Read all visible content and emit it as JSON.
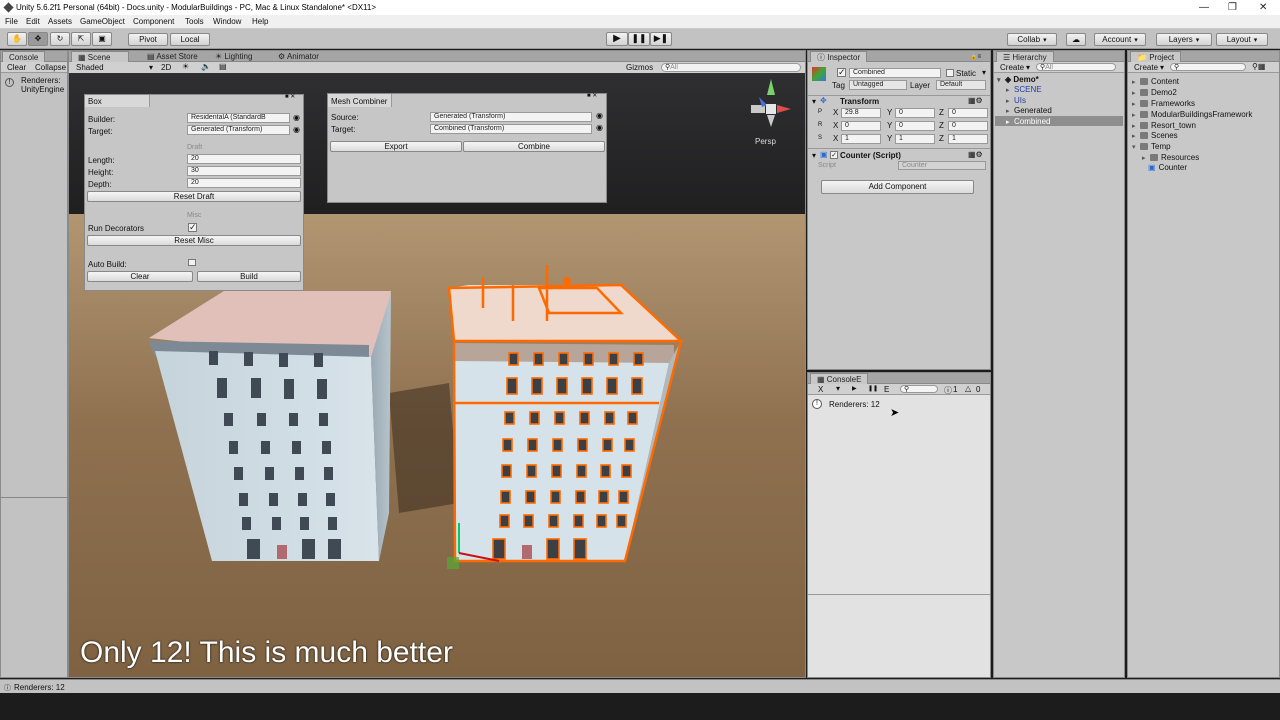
{
  "window": {
    "title": "Unity 5.6.2f1 Personal (64bit) - Docs.unity - ModularBuildings - PC, Mac & Linux Standalone* <DX11>",
    "controls": [
      "—",
      "❐",
      "✕"
    ]
  },
  "menu": [
    "File",
    "Edit",
    "Assets",
    "GameObject",
    "Component",
    "Tools",
    "Window",
    "Help"
  ],
  "toolbar": {
    "pivot": "Pivot",
    "local": "Local",
    "collab": "Collab",
    "account": "Account",
    "layers": "Layers",
    "layout": "Layout"
  },
  "console_left": {
    "tab": "Console",
    "clear": "Clear",
    "collapse": "Collapse",
    "message_line1": "Renderers:",
    "message_line2": "UnityEngine"
  },
  "scene": {
    "tabs": [
      "Scene",
      "Asset Store",
      "Lighting",
      "Animator"
    ],
    "shading": "Shaded",
    "mode2d": "2D",
    "gizmos": "Gizmos",
    "search_placeholder": "All",
    "persp": "Persp",
    "subtitle": "Only 12! This is much better"
  },
  "box_window": {
    "title": "Box",
    "builder_label": "Builder:",
    "builder_value": "ResidentalA (StandardB",
    "target_label": "Target:",
    "target_value": "Generated (Transform)",
    "draft_header": "Draft",
    "length_label": "Length:",
    "length_value": "20",
    "height_label": "Height:",
    "height_value": "30",
    "depth_label": "Depth:",
    "depth_value": "20",
    "reset_draft": "Reset Draft",
    "misc_header": "Misc",
    "run_decorators": "Run Decorators",
    "reset_misc": "Reset Misc",
    "auto_build": "Auto Build:",
    "clear": "Clear",
    "build": "Build"
  },
  "mesh_combiner": {
    "title": "Mesh Combiner",
    "source_label": "Source:",
    "source_value": "Generated (Transform)",
    "target_label": "Target:",
    "target_value": "Combined (Transform)",
    "export": "Export",
    "combine": "Combine"
  },
  "inspector": {
    "tab": "Inspector",
    "object_name": "Combined",
    "static": "Static",
    "tag_label": "Tag",
    "tag_value": "Untagged",
    "layer_label": "Layer",
    "layer_value": "Default",
    "transform_title": "Transform",
    "position": {
      "x": "29.8",
      "y": "0",
      "z": "0"
    },
    "rotation": {
      "x": "0",
      "y": "0",
      "z": "0"
    },
    "scale": {
      "x": "1",
      "y": "1",
      "z": "1"
    },
    "axis_x": "X",
    "axis_y": "Y",
    "axis_z": "Z",
    "row_p": "P",
    "row_r": "R",
    "row_s": "S",
    "counter_title": "Counter (Script)",
    "script_label": "Script",
    "script_value": "Counter",
    "add_component": "Add Component"
  },
  "console_e": {
    "tab": "ConsoleE",
    "btn_x": "X",
    "btn_e": "E",
    "count_info": "1",
    "count_warn": "0",
    "message": "Renderers: 12"
  },
  "hierarchy": {
    "tab": "Hierarchy",
    "create": "Create",
    "search_placeholder": "All",
    "root": "Demo*",
    "items": [
      "SCENE",
      "UIs",
      "Generated",
      "Combined"
    ]
  },
  "project": {
    "tab": "Project",
    "create": "Create",
    "items": [
      "Content",
      "Demo2",
      "Frameworks",
      "ModularBuildingsFramework",
      "Resort_town",
      "Scenes",
      "Temp"
    ],
    "temp_children": [
      "Resources",
      "Counter"
    ]
  },
  "status": {
    "text": "Renderers: 12"
  },
  "colors": {
    "selection_outline": "#ff6a00",
    "panel_bg": "#c2c2c2",
    "ground": "#8b6d47"
  }
}
